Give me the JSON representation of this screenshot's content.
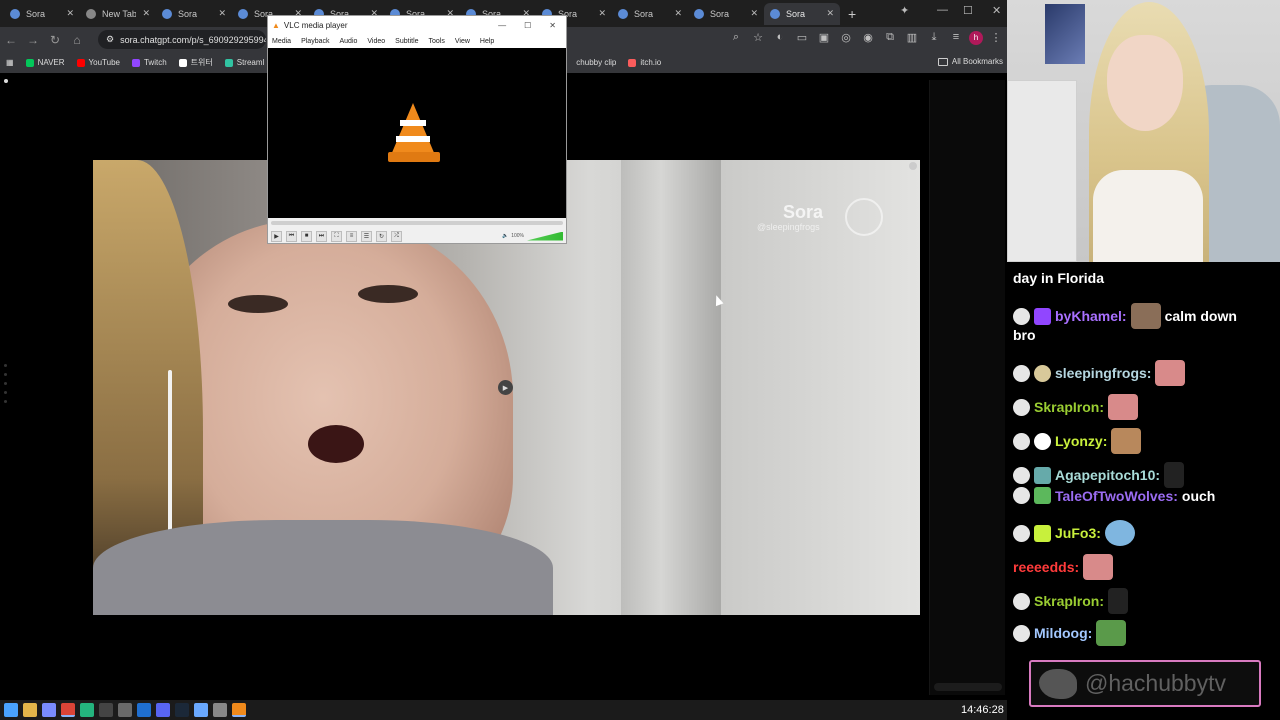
{
  "browser": {
    "tabs": [
      {
        "label": "Sora",
        "active": false
      },
      {
        "label": "New Tab",
        "active": false
      },
      {
        "label": "Sora",
        "active": false
      },
      {
        "label": "Sora",
        "active": false
      },
      {
        "label": "Sora",
        "active": false
      },
      {
        "label": "Sora",
        "active": false
      },
      {
        "label": "Sora",
        "active": false
      },
      {
        "label": "Sora",
        "active": false
      },
      {
        "label": "Sora",
        "active": false
      },
      {
        "label": "Sora",
        "active": false
      },
      {
        "label": "Sora",
        "active": true
      }
    ],
    "url": "sora.chatgpt.com/p/s_6909292959948",
    "bookmarks": [
      {
        "label": "NAVER",
        "color": "#03c75a"
      },
      {
        "label": "YouTube",
        "color": "#ff0000"
      },
      {
        "label": "Twitch",
        "color": "#9146ff"
      },
      {
        "label": "트위터",
        "color": "#ffffff"
      },
      {
        "label": "Streaml",
        "color": "#31c3a2"
      },
      {
        "label": "chubby clip",
        "color": "#7a7a7a"
      },
      {
        "label": "itch.io",
        "color": "#fa5c5c"
      }
    ],
    "all_bookmarks": "All Bookmarks",
    "profile_initial": "h"
  },
  "video": {
    "watermark": "Sora",
    "handle": "@sleepingfrogs"
  },
  "vlc": {
    "title": "VLC media player",
    "menu": [
      "Media",
      "Playback",
      "Audio",
      "Video",
      "Subtitle",
      "Tools",
      "View",
      "Help"
    ],
    "volume": "100%"
  },
  "chat": {
    "top_fragment": "day in Florida",
    "messages": [
      {
        "user": "byKhamel:",
        "color": "#a970ff",
        "text": "calm down",
        "cont": "bro"
      },
      {
        "user": "sleepingfrogs:",
        "color": "#b5d6e0",
        "text": ""
      },
      {
        "user": "SkrapIron:",
        "color": "#9acd32",
        "text": ""
      },
      {
        "user": "Lyonzy:",
        "color": "#c8f03c",
        "text": ""
      },
      {
        "user": "Agapepitoch10:",
        "color": "#a9dcd8",
        "text": ""
      },
      {
        "user": "TaleOfTwoWolves:",
        "color": "#9b6cf2",
        "text": "ouch"
      },
      {
        "user": "JuFo3:",
        "color": "#c8f03c",
        "text": ""
      },
      {
        "user": "reeeedds:",
        "color": "#ff3b3b",
        "text": ""
      },
      {
        "user": "SkrapIron:",
        "color": "#9acd32",
        "text": ""
      },
      {
        "user": "Mildoog:",
        "color": "#a3c8ff",
        "text": ""
      }
    ]
  },
  "overlay": {
    "handle": "@hachubbytv",
    "accent": "#d87ac0"
  },
  "taskbar": {
    "clock": "14:46:28"
  }
}
